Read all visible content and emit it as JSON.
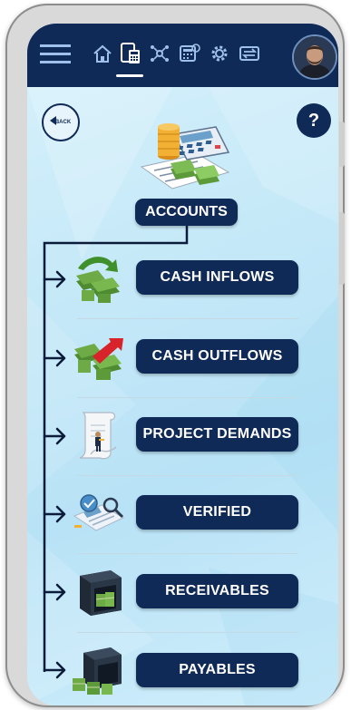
{
  "topbar": {
    "icons": [
      "menu-icon",
      "home-icon",
      "accounts-icon",
      "network-icon",
      "calculator-icon",
      "settings-icon",
      "exchange-icon"
    ],
    "active": "accounts-icon"
  },
  "header": {
    "back_label": "BACK",
    "help_label": "?"
  },
  "root": {
    "label": "ACCOUNTS",
    "icon": "accounts-illustration-icon"
  },
  "items": [
    {
      "label": "CASH INFLOWS",
      "icon": "cash-inflows-icon"
    },
    {
      "label": "CASH OUTFLOWS",
      "icon": "cash-outflows-icon"
    },
    {
      "label": "PROJECT DEMANDS",
      "icon": "project-demands-icon"
    },
    {
      "label": "VERIFIED",
      "icon": "verified-icon"
    },
    {
      "label": "RECEIVABLES",
      "icon": "receivables-icon"
    },
    {
      "label": "PAYABLES",
      "icon": "payables-icon"
    }
  ],
  "colors": {
    "navy": "#0f2a57",
    "background": "#c6e9f8",
    "money_green": "#5c9a3a",
    "red": "#d8232a"
  }
}
